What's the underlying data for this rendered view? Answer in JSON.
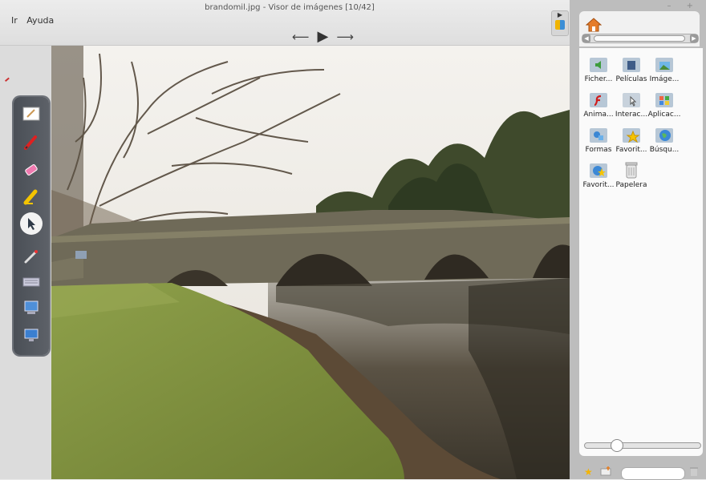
{
  "window": {
    "title": "brandomil.jpg - Visor de imágenes [10/42]",
    "menu": [
      "Ir",
      "Ayuda"
    ],
    "controls": "– +"
  },
  "navigation": {
    "prev_icon": "arrow-left-icon",
    "play_icon": "play-icon",
    "next_icon": "arrow-right-icon"
  },
  "toolbar": {
    "tools": [
      "board-icon",
      "pen-icon",
      "eraser-icon",
      "highlighter-icon",
      "pointer-icon",
      "laser-icon",
      "keyboard-icon",
      "capture-icon",
      "desktop-icon"
    ],
    "selected": "pointer-icon"
  },
  "library": {
    "items": [
      {
        "label": "Ficher...",
        "icon": "audio-folder-icon"
      },
      {
        "label": "Películas",
        "icon": "movie-folder-icon"
      },
      {
        "label": "Imáge...",
        "icon": "image-folder-icon"
      },
      {
        "label": "Anima...",
        "icon": "flash-folder-icon"
      },
      {
        "label": "Interac...",
        "icon": "interactive-folder-icon"
      },
      {
        "label": "Aplicac...",
        "icon": "apps-folder-icon"
      },
      {
        "label": "Formas",
        "icon": "shapes-folder-icon"
      },
      {
        "label": "Favorit...",
        "icon": "favorites-folder-icon"
      },
      {
        "label": "Búsqu...",
        "icon": "web-search-icon"
      },
      {
        "label": "Favorit...",
        "icon": "favorites-web-icon"
      },
      {
        "label": "Papelera",
        "icon": "trash-icon"
      }
    ]
  },
  "footer": {
    "search_placeholder": ""
  },
  "colors": {
    "toolbar": "#555a61",
    "panel": "#fafafa",
    "accent": "#e67e22"
  }
}
